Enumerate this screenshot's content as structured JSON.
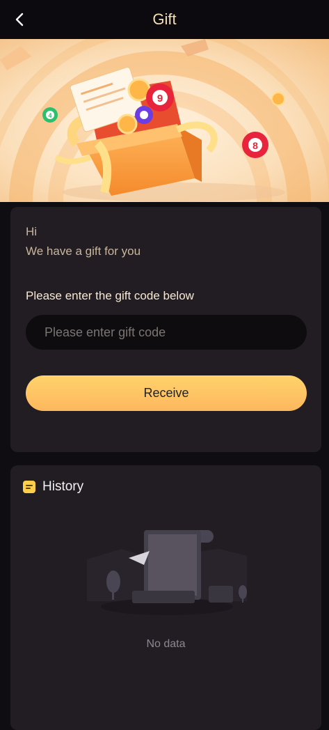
{
  "header": {
    "title": "Gift"
  },
  "gift_card": {
    "greeting": "Hi",
    "subtitle": "We have a gift for you",
    "code_label": "Please enter the gift code below",
    "code_input_value": "",
    "code_input_placeholder": "Please enter gift code",
    "receive_label": "Receive"
  },
  "history": {
    "title": "History",
    "empty_text": "No data"
  },
  "banner": {
    "ball_labels": [
      "4",
      "9",
      "8"
    ]
  },
  "colors": {
    "page_bg": "#0f0d11",
    "card_bg": "#221d22",
    "accent": "#fdb75e",
    "title_text": "#f5dfb9"
  },
  "icons": {
    "back": "chevron-left-icon",
    "history": "notepad-icon"
  }
}
